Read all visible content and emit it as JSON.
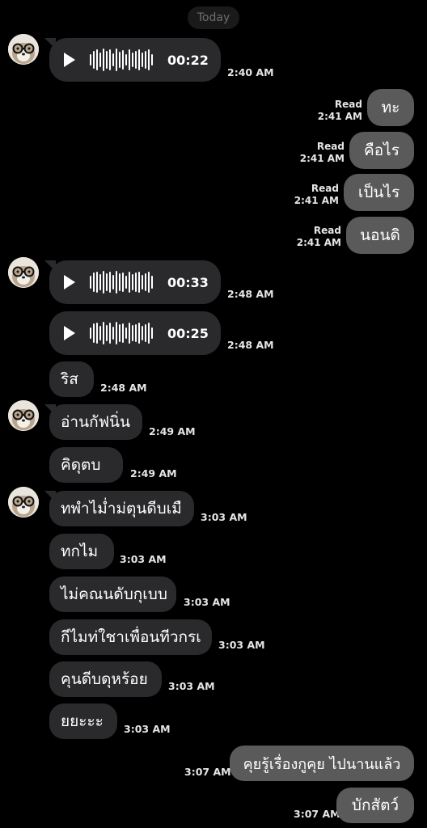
{
  "date_label": "Today",
  "messages": [
    {
      "dir": "in",
      "kind": "voice",
      "duration": "00:22",
      "time": "2:40 AM"
    },
    {
      "dir": "out",
      "text": "ทะ",
      "status": "Read",
      "time": "2:41 AM"
    },
    {
      "dir": "out",
      "text": "คือไร",
      "status": "Read",
      "time": "2:41 AM"
    },
    {
      "dir": "out",
      "text": "เป็นไร",
      "status": "Read",
      "time": "2:41 AM"
    },
    {
      "dir": "out",
      "text": "นอนดิ",
      "status": "Read",
      "time": "2:41 AM"
    },
    {
      "dir": "in",
      "kind": "voice",
      "duration": "00:33",
      "time": "2:48 AM"
    },
    {
      "dir": "in",
      "kind": "voice",
      "duration": "00:25",
      "time": "2:48 AM"
    },
    {
      "dir": "in",
      "text": "ริส",
      "time": "2:48 AM"
    },
    {
      "dir": "in",
      "text": "อ่านกัฟนิ่น",
      "time": "2:49 AM"
    },
    {
      "dir": "in",
      "text": "คิดุตบ",
      "time": "2:49 AM"
    },
    {
      "dir": "in",
      "text": "ทพำไม่ำม่ตุนดีบเมื",
      "time": "3:03 AM"
    },
    {
      "dir": "in",
      "text": "ทกไม",
      "time": "3:03 AM"
    },
    {
      "dir": "in",
      "text": "ไม่คณนดับกุเบบ",
      "time": "3:03 AM"
    },
    {
      "dir": "in",
      "text": "กีไมท่ใชาเพื่อนทีวกรเ",
      "time": "3:03 AM"
    },
    {
      "dir": "in",
      "text": "คุนดีบดุหร้อย",
      "time": "3:03 AM"
    },
    {
      "dir": "in",
      "text": "ยยะะะ",
      "time": "3:03 AM"
    },
    {
      "dir": "out",
      "text": "คุยรู้เรื่องกูคุย ไปนานแล้ว",
      "time": "3:07 AM"
    },
    {
      "dir": "out",
      "text": "บักสัตว์",
      "time": "3:07 AM"
    }
  ]
}
